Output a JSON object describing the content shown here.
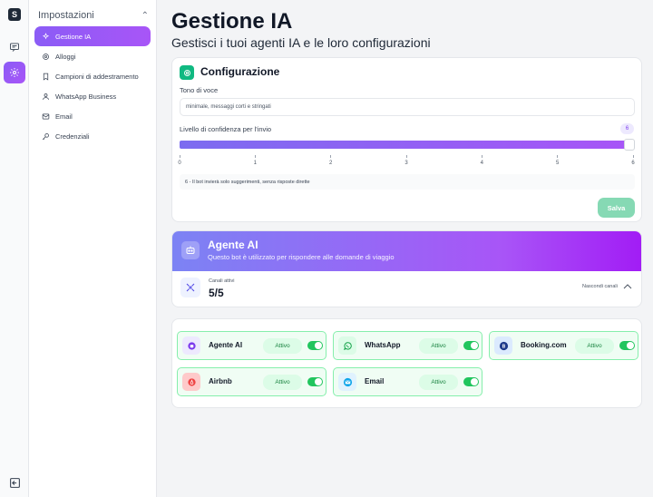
{
  "rail": {
    "logo_letter": "S",
    "icons": [
      "logo-icon",
      "chat-icon",
      "gear-icon",
      "logout-icon"
    ]
  },
  "sidebar": {
    "heading": "Impostazioni",
    "items": [
      {
        "label": "Gestione IA",
        "icon": "sparkles-icon",
        "active": true
      },
      {
        "label": "Alloggi",
        "icon": "gear-icon",
        "active": false
      },
      {
        "label": "Campioni di addestramento",
        "icon": "bookmark-icon",
        "active": false
      },
      {
        "label": "WhatsApp Business",
        "icon": "user-icon",
        "active": false
      },
      {
        "label": "Email",
        "icon": "mail-icon",
        "active": false
      },
      {
        "label": "Credenziali",
        "icon": "key-icon",
        "active": false
      }
    ]
  },
  "page": {
    "title": "Gestione IA",
    "subtitle": "Gestisci i tuoi agenti IA e le loro configurazioni"
  },
  "config": {
    "title": "Configurazione",
    "tone_label": "Tono di voce",
    "tone_value": "minimale, messaggi corti e stringati",
    "confidence_label": "Livello di confidenza per l'invio",
    "confidence_value": "6",
    "confidence_fraction": 1.0,
    "ticks": [
      "0",
      "1",
      "2",
      "3",
      "4",
      "5",
      "6"
    ],
    "hint": "6 - Il bot invierà solo suggerimenti, senza risposte dirette",
    "save_label": "Salva"
  },
  "agent": {
    "name": "Agente AI",
    "description": "Questo bot è utilizzato per rispondere alle domande di viaggio",
    "channels_label": "Canali attivi",
    "channels_value": "5/5",
    "hide_label": "Nascondi canali"
  },
  "channels": [
    {
      "name": "Agente AI",
      "status": "Attivo",
      "icon": "bot-icon",
      "icon_bg": "#ede9fe",
      "icon_color": "#7c3aed"
    },
    {
      "name": "WhatsApp",
      "status": "Attivo",
      "icon": "whatsapp-icon",
      "icon_bg": "#dcfce7",
      "icon_color": "#16a34a"
    },
    {
      "name": "Booking.com",
      "status": "Attivo",
      "icon": "booking-icon",
      "icon_bg": "#dbeafe",
      "icon_color": "#1e3a8a"
    },
    {
      "name": "Airbnb",
      "status": "Attivo",
      "icon": "airbnb-icon",
      "icon_bg": "#fee2e2",
      "icon_color": "#ef4444"
    },
    {
      "name": "Email",
      "status": "Attivo",
      "icon": "mail-icon",
      "icon_bg": "#e0f2fe",
      "icon_color": "#0ea5e9"
    }
  ],
  "colors": {
    "accent": "#a855f7",
    "success": "#22c55e",
    "save_button": "#86d9b4"
  }
}
